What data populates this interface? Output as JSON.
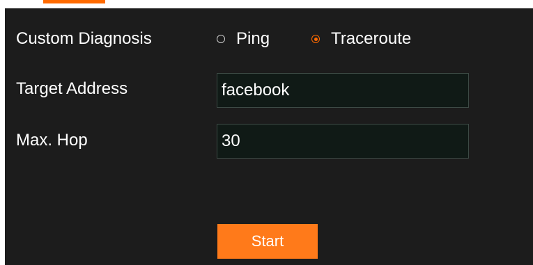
{
  "diagnosis": {
    "label": "Custom Diagnosis",
    "options": [
      {
        "label": "Ping",
        "checked": false
      },
      {
        "label": "Traceroute",
        "checked": true
      }
    ]
  },
  "target": {
    "label": "Target Address",
    "value": "facebook"
  },
  "max_hop": {
    "label": "Max. Hop",
    "value": "30"
  },
  "start_button": {
    "label": "Start"
  },
  "colors": {
    "accent": "#ff6a00",
    "panel_bg": "#1c1c1c",
    "input_bg": "#101a16"
  }
}
